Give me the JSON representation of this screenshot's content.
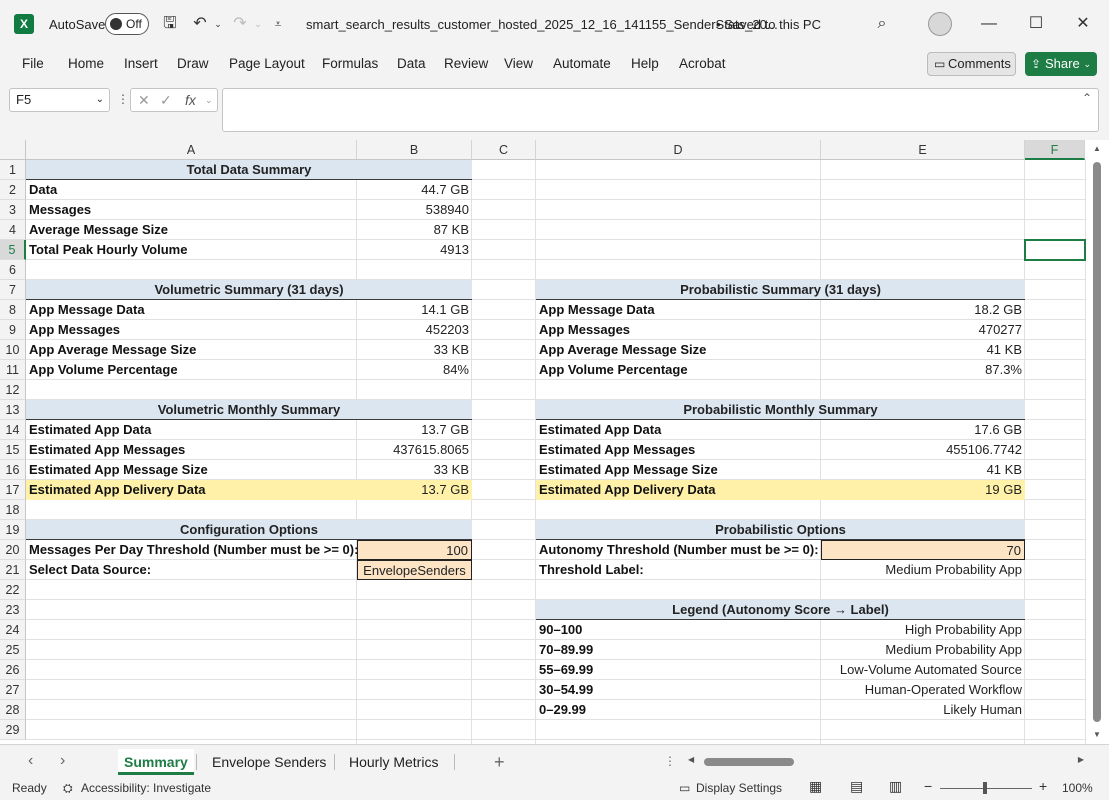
{
  "titlebar": {
    "app_icon": "excel-icon",
    "autosave_label": "AutoSave",
    "autosave_state": "Off",
    "doc_title": "smart_search_results_customer_hosted_2025_12_16_141155_SenderStats_20...",
    "save_status": "• Saved to this PC"
  },
  "menu": [
    "File",
    "Home",
    "Insert",
    "Draw",
    "Page Layout",
    "Formulas",
    "Data",
    "Review",
    "View",
    "Automate",
    "Help",
    "Acrobat"
  ],
  "buttons": {
    "comments": "Comments",
    "share": "Share"
  },
  "formula": {
    "name_box": "F5",
    "fx": "fx",
    "value": ""
  },
  "columns": [
    "A",
    "B",
    "C",
    "D",
    "E",
    "F"
  ],
  "rows": [
    "1",
    "2",
    "3",
    "4",
    "5",
    "6",
    "7",
    "8",
    "9",
    "10",
    "11",
    "12",
    "13",
    "14",
    "15",
    "16",
    "17",
    "18",
    "19",
    "20",
    "21",
    "22",
    "23",
    "24",
    "25",
    "26",
    "27",
    "28",
    "29"
  ],
  "left": {
    "total_header": "Total Data Summary",
    "total": [
      {
        "label": "Data",
        "value": "44.7 GB"
      },
      {
        "label": "Messages",
        "value": "538940"
      },
      {
        "label": "Average Message Size",
        "value": "87 KB"
      },
      {
        "label": "Total Peak Hourly Volume",
        "value": "4913"
      }
    ],
    "vol_header": "Volumetric Summary (31 days)",
    "vol": [
      {
        "label": "App Message Data",
        "value": "14.1 GB"
      },
      {
        "label": "App Messages",
        "value": "452203"
      },
      {
        "label": "App Average Message Size",
        "value": "33 KB"
      },
      {
        "label": "App Volume Percentage",
        "value": "84%"
      }
    ],
    "volm_header": "Volumetric Monthly Summary",
    "volm": [
      {
        "label": "Estimated App Data",
        "value": "13.7 GB"
      },
      {
        "label": "Estimated App Messages",
        "value": "437615.8065"
      },
      {
        "label": "Estimated App Message Size",
        "value": "33 KB"
      },
      {
        "label": "Estimated App Delivery Data",
        "value": "13.7 GB"
      }
    ],
    "config_header": "Configuration Options",
    "config": [
      {
        "label": "Messages Per Day Threshold (Number must be >= 0):",
        "value": "100"
      },
      {
        "label": "Select Data Source:",
        "value": "EnvelopeSenders"
      }
    ]
  },
  "right": {
    "prob_header": "Probabilistic Summary (31 days)",
    "prob": [
      {
        "label": "App Message Data",
        "value": "18.2 GB"
      },
      {
        "label": "App Messages",
        "value": "470277"
      },
      {
        "label": "App Average Message Size",
        "value": "41 KB"
      },
      {
        "label": "App Volume Percentage",
        "value": "87.3%"
      }
    ],
    "probm_header": "Probabilistic Monthly Summary",
    "probm": [
      {
        "label": "Estimated App Data",
        "value": "17.6 GB"
      },
      {
        "label": "Estimated App Messages",
        "value": "455106.7742"
      },
      {
        "label": "Estimated App Message Size",
        "value": "41 KB"
      },
      {
        "label": "Estimated App Delivery Data",
        "value": "19 GB"
      }
    ],
    "popt_header": "Probabilistic Options",
    "popt": [
      {
        "label": "Autonomy Threshold (Number must be >= 0):",
        "value": "70"
      },
      {
        "label": "Threshold Label:",
        "value": "Medium Probability App"
      }
    ],
    "legend_header": "Legend (Autonomy Score → Label)",
    "legend": [
      {
        "label": "90–100",
        "value": "High Probability App"
      },
      {
        "label": "70–89.99",
        "value": "Medium Probability App"
      },
      {
        "label": "55–69.99",
        "value": "Low-Volume Automated Source"
      },
      {
        "label": "30–54.99",
        "value": "Human-Operated Workflow"
      },
      {
        "label": "0–29.99",
        "value": "Likely Human"
      }
    ]
  },
  "sheets": [
    {
      "name": "Summary",
      "active": true
    },
    {
      "name": "Envelope Senders",
      "active": false
    },
    {
      "name": "Hourly Metrics",
      "active": false
    }
  ],
  "status": {
    "ready": "Ready",
    "accessibility": "Accessibility: Investigate",
    "display_settings": "Display Settings",
    "zoom": "100%"
  },
  "colors": {
    "accent": "#1e7c45",
    "header_fill": "#dce6f1",
    "highlight": "#fff2a8",
    "input_fill": "#fce4c4"
  }
}
